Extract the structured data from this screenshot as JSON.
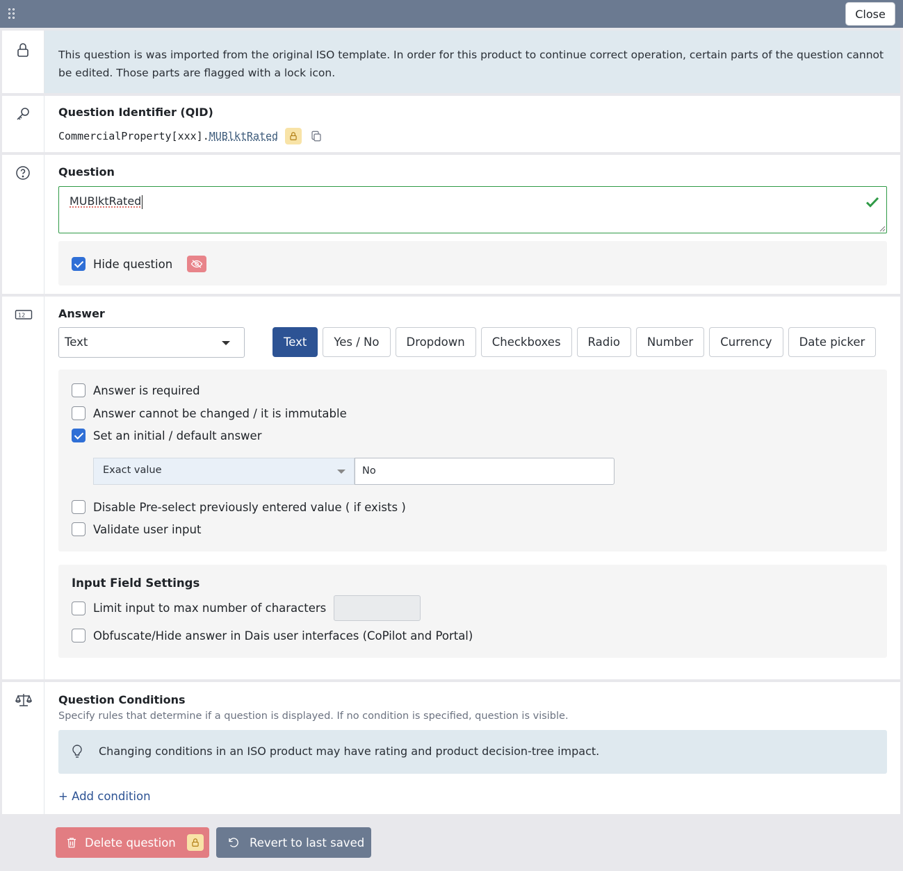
{
  "topbar": {
    "close_label": "Close"
  },
  "notice": {
    "text": "This question is was imported from the original ISO template. In order for this product to continue correct operation, certain parts of the question cannot be edited. Those parts are flagged with a lock icon."
  },
  "qid": {
    "title": "Question Identifier (QID)",
    "prefix": "CommercialProperty[xxx].",
    "link": "MUBlktRated"
  },
  "question": {
    "title": "Question",
    "value": "MUBlktRated",
    "hide_label": "Hide question",
    "hide_checked": true
  },
  "answer": {
    "title": "Answer",
    "type_select": "Text",
    "tabs": [
      {
        "label": "Text",
        "active": true
      },
      {
        "label": "Yes / No",
        "active": false
      },
      {
        "label": "Dropdown",
        "active": false
      },
      {
        "label": "Checkboxes",
        "active": false
      },
      {
        "label": "Radio",
        "active": false
      },
      {
        "label": "Number",
        "active": false
      },
      {
        "label": "Currency",
        "active": false
      },
      {
        "label": "Date picker",
        "active": false
      }
    ],
    "options": {
      "required": "Answer is required",
      "immutable": "Answer cannot be changed / it is immutable",
      "default": "Set an initial / default answer",
      "default_mode": "Exact value",
      "default_value": "No",
      "preselect": "Disable Pre-select previously entered value ( if exists )",
      "validate": "Validate user input"
    },
    "input_settings": {
      "title": "Input Field Settings",
      "limit": "Limit input to max number of characters",
      "obfuscate": "Obfuscate/Hide answer in Dais user interfaces (CoPilot and Portal)"
    }
  },
  "conditions": {
    "title": "Question Conditions",
    "subtitle": "Specify rules that determine if a question is displayed. If no condition is specified, question is visible.",
    "tip": "Changing conditions in an ISO product may have rating and product decision-tree impact.",
    "add_label": "+ Add condition"
  },
  "footer": {
    "delete_label": "Delete question",
    "revert_label": "Revert to last saved"
  },
  "colors": {
    "primary": "#2d5394",
    "topbar": "#6b7a91",
    "danger": "#e27d82",
    "success": "#2f9a46",
    "lock": "#f8e3a7"
  }
}
